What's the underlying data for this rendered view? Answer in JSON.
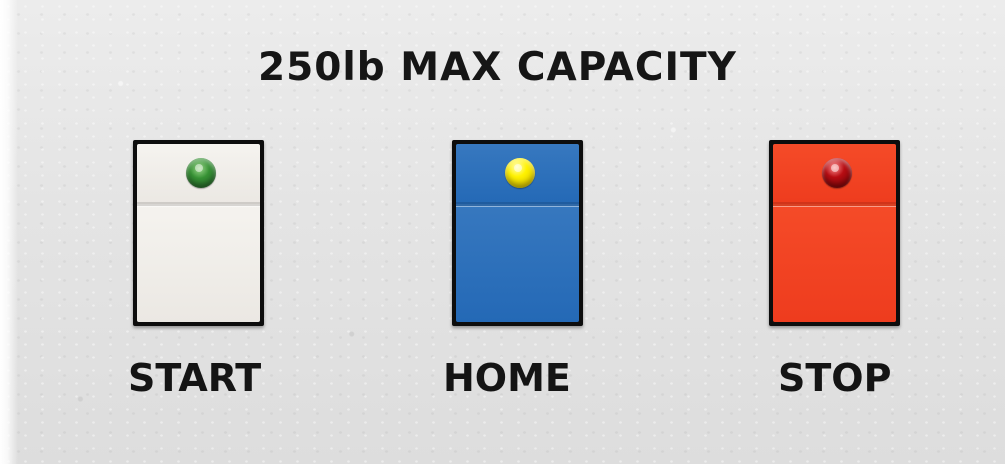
{
  "panel": {
    "title": "250lb MAX CAPACITY",
    "background_color": "#e6e6e6"
  },
  "buttons": [
    {
      "label": "START",
      "cap_color": "#f0eee9",
      "indicator_color": "#2f8a2e",
      "icon": "green-led-icon"
    },
    {
      "label": "HOME",
      "cap_color": "#2a6fbc",
      "indicator_color": "#fff200",
      "icon": "yellow-led-icon"
    },
    {
      "label": "STOP",
      "cap_color": "#f24425",
      "indicator_color": "#8e0a0d",
      "icon": "red-led-icon"
    }
  ]
}
